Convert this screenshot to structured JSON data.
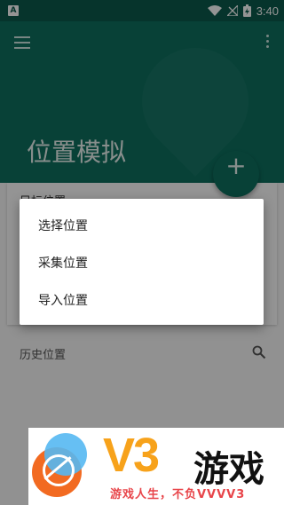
{
  "status_bar": {
    "app_badge": "A",
    "time": "3:40"
  },
  "header": {
    "title": "位置模拟",
    "fab_label": "+"
  },
  "card": {
    "label": "目标位置"
  },
  "history": {
    "label": "历史位置"
  },
  "menu": {
    "items": [
      {
        "label": "选择位置"
      },
      {
        "label": "采集位置"
      },
      {
        "label": "导入位置"
      }
    ]
  },
  "banner": {
    "brand": "V3",
    "brand_text": "游戏",
    "slogan": "游戏人生，不负VVVV3"
  },
  "colors": {
    "primary": "#0e7160",
    "status_bar": "#0b5b4c",
    "brand_orange": "#f7a21b",
    "slogan_red": "#e8454a"
  }
}
